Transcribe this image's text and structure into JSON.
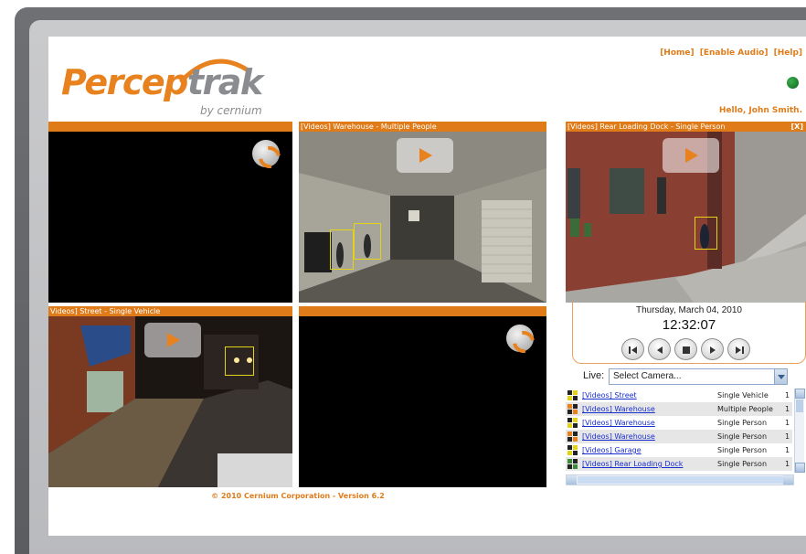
{
  "brand": {
    "logo_main": "Percep",
    "logo_accent": "trak",
    "logo_sub": "by cernium"
  },
  "header": {
    "links": [
      "[Home]",
      "[Enable Audio]",
      "[Help]"
    ],
    "greeting": "Hello, John Smith.",
    "status_color": "#1f7a2b"
  },
  "panes": [
    {
      "title": "",
      "has_video": false
    },
    {
      "title": "[Videos] Warehouse - Multiple People",
      "has_video": true
    },
    {
      "title": "[Videos] Rear Loading Dock - Single Person",
      "close": "[X]",
      "has_video": true
    },
    {
      "title": "Videos] Street - Single Vehicle",
      "has_video": true
    },
    {
      "title": "",
      "has_video": false
    }
  ],
  "clock": {
    "date": "Thursday, March 04, 2010",
    "time": "12:32:07"
  },
  "transport_icons": [
    "skip-back-icon",
    "step-back-icon",
    "stop-icon",
    "play-icon",
    "skip-forward-icon"
  ],
  "live": {
    "label": "Live:",
    "selected": "Select Camera..."
  },
  "events": [
    {
      "camera": "[Videos] Street",
      "type": "Single Vehicle",
      "count": "1"
    },
    {
      "camera": "[Videos] Warehouse",
      "type": "Multiple People",
      "count": "1"
    },
    {
      "camera": "[Videos] Warehouse",
      "type": "Single Person",
      "count": "1"
    },
    {
      "camera": "[Videos] Warehouse",
      "type": "Single Person",
      "count": "1"
    },
    {
      "camera": "[Videos] Garage",
      "type": "Single Person",
      "count": "1"
    },
    {
      "camera": "[Videos] Rear Loading Dock",
      "type": "Single Person",
      "count": "1"
    }
  ],
  "footer": "© 2010 Cernium Corporation - Version 6.2",
  "colors": {
    "accent": "#e07b1a",
    "link": "#1a2fd0",
    "logo_gray": "#8a8c8f"
  }
}
